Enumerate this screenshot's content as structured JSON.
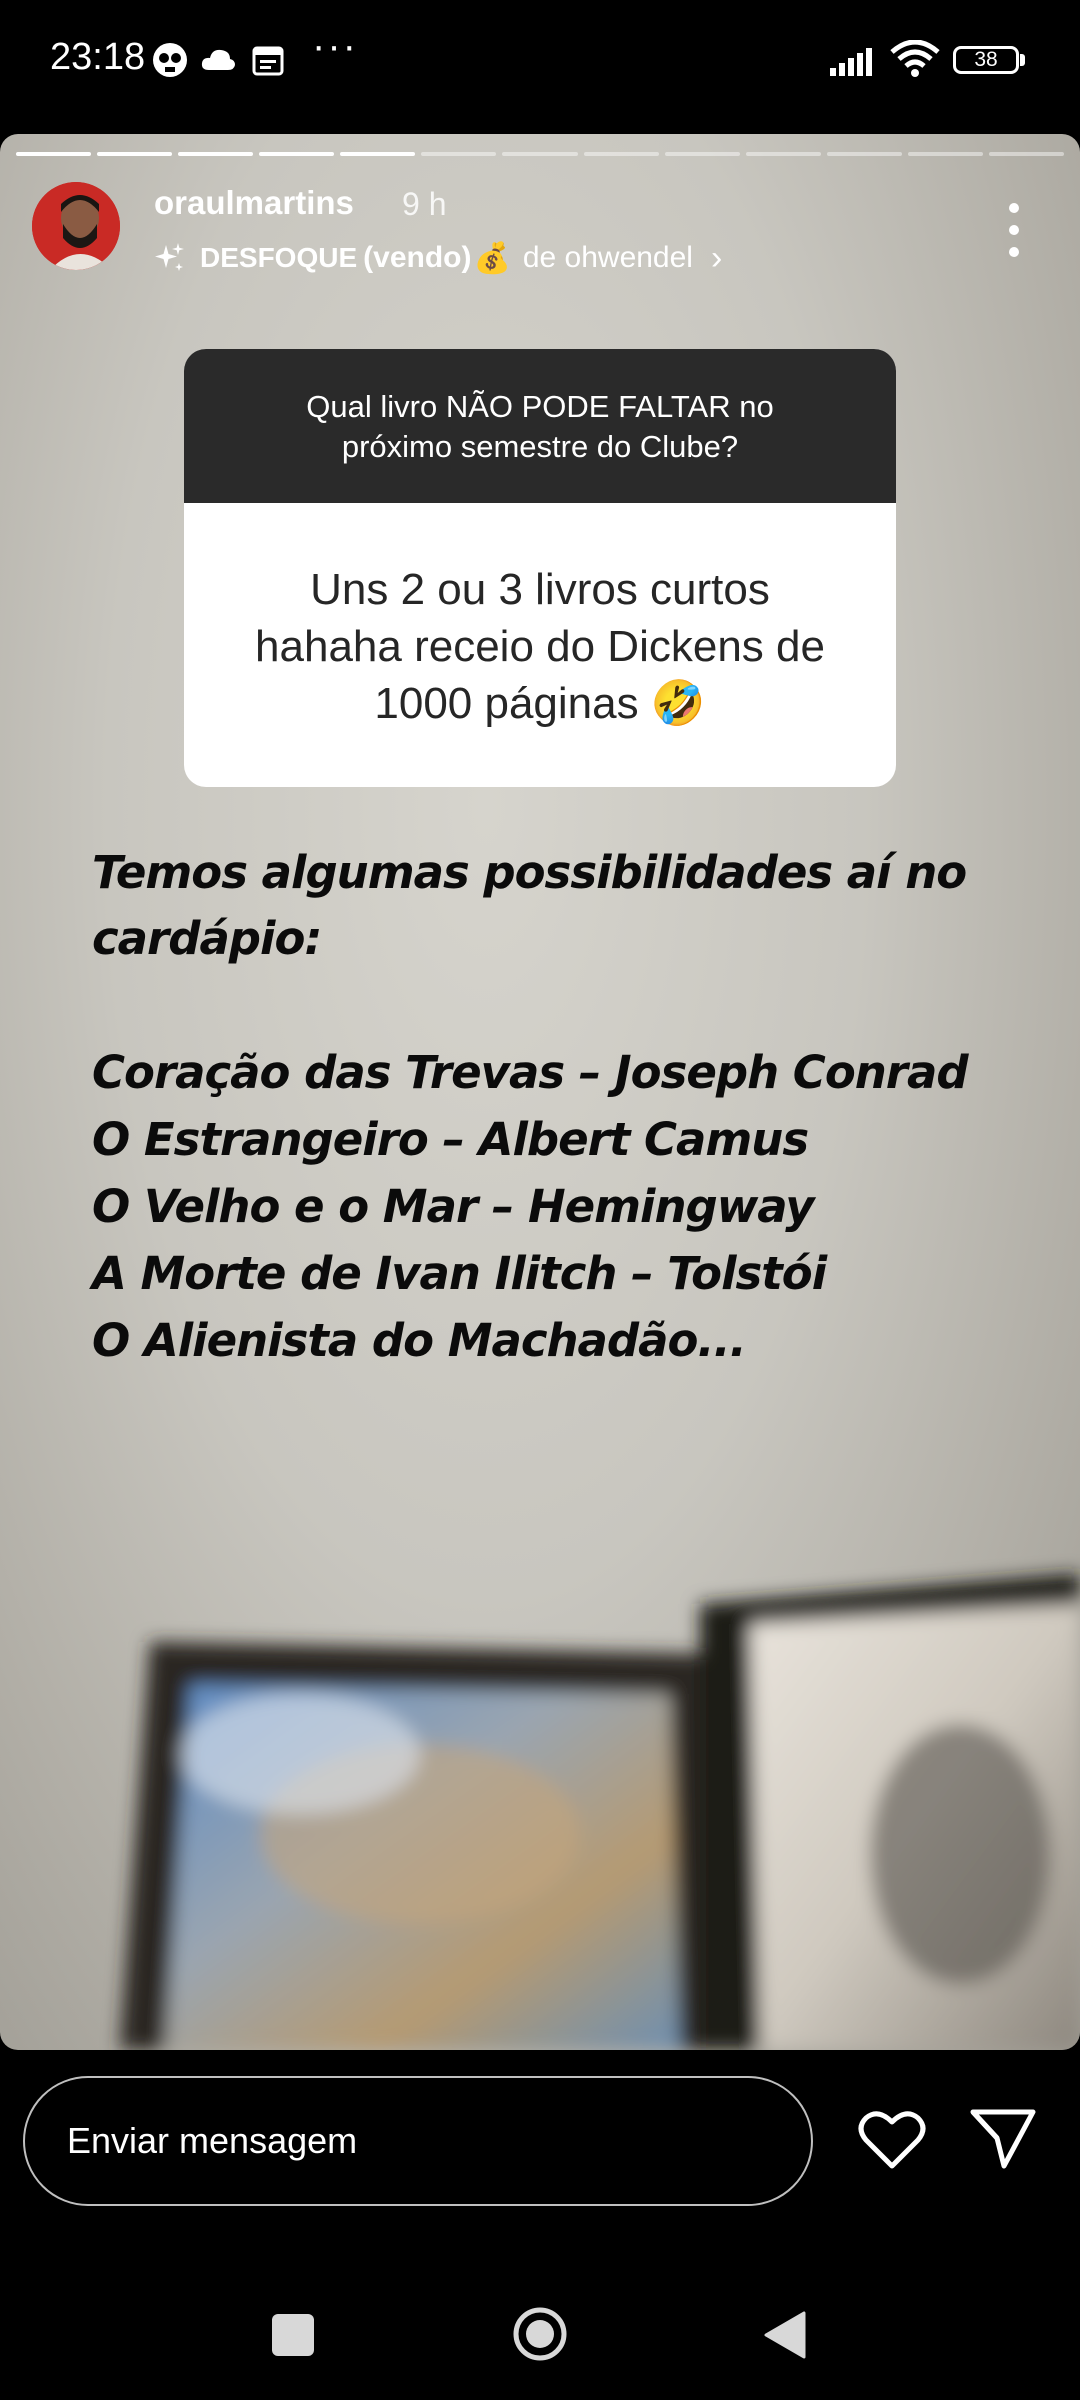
{
  "status_bar": {
    "time": "23:18",
    "more": "···",
    "battery": "38"
  },
  "story": {
    "progress": {
      "total_segments": 13,
      "completed_segments": 5
    },
    "username": "oraulmartins",
    "time_ago": "9 h",
    "effect": {
      "name": "DESFOQUE",
      "suffix": "(vendo)",
      "emoji": "💰",
      "by": "de ohwendel",
      "chevron": "›"
    },
    "question_card": {
      "question_line1": "Qual livro NÃO PODE FALTAR no",
      "question_line2": "próximo semestre do Clube?",
      "answer_line1": "Uns 2 ou 3 livros curtos",
      "answer_line2": "hahaha receio do Dickens de",
      "answer_line3": "1000 páginas 🤣"
    },
    "text_lines": [
      "Temos algumas possibilidades aí no",
      "cardápio:",
      "Coração das Trevas – Joseph Conrad",
      "O Estrangeiro – Albert Camus",
      "O Velho e o Mar – Hemingway",
      "A Morte de Ivan Ilitch – Tolstói",
      "O Alienista do Machadão..."
    ]
  },
  "reply_bar": {
    "placeholder": "Enviar mensagem"
  }
}
